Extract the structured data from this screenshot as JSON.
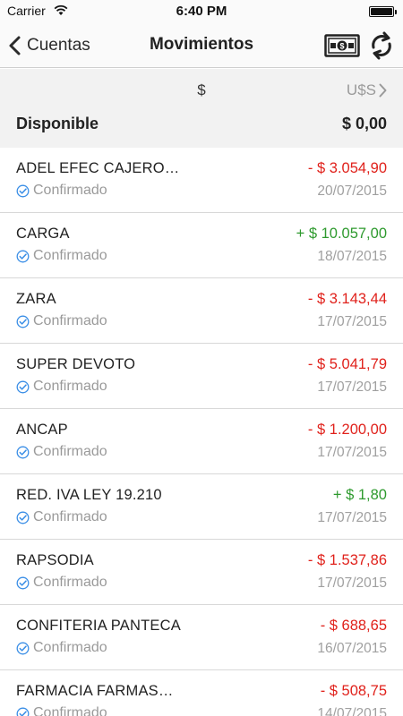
{
  "status_bar": {
    "carrier": "Carrier",
    "time": "6:40 PM"
  },
  "nav": {
    "back_label": "Cuentas",
    "title": "Movimientos"
  },
  "currency": {
    "local": "$",
    "foreign": "U$S"
  },
  "balance": {
    "label": "Disponible",
    "value": "$ 0,00"
  },
  "colors": {
    "negative": "#e0211b",
    "positive": "#2e9a2e",
    "status_icon": "#3a8ee6"
  },
  "transactions": [
    {
      "name": "ADEL EFEC CAJERO…",
      "status": "Confirmado",
      "amount": "- $ 3.054,90",
      "type": "neg",
      "date": "20/07/2015"
    },
    {
      "name": "CARGA",
      "status": "Confirmado",
      "amount": "+ $ 10.057,00",
      "type": "pos",
      "date": "18/07/2015"
    },
    {
      "name": "ZARA",
      "status": "Confirmado",
      "amount": "- $ 3.143,44",
      "type": "neg",
      "date": "17/07/2015"
    },
    {
      "name": "SUPER DEVOTO",
      "status": "Confirmado",
      "amount": "- $ 5.041,79",
      "type": "neg",
      "date": "17/07/2015"
    },
    {
      "name": "ANCAP",
      "status": "Confirmado",
      "amount": "- $ 1.200,00",
      "type": "neg",
      "date": "17/07/2015"
    },
    {
      "name": "RED. IVA LEY 19.210",
      "status": "Confirmado",
      "amount": "+ $ 1,80",
      "type": "pos",
      "date": "17/07/2015"
    },
    {
      "name": "RAPSODIA",
      "status": "Confirmado",
      "amount": "- $ 1.537,86",
      "type": "neg",
      "date": "17/07/2015"
    },
    {
      "name": "CONFITERIA PANTECA",
      "status": "Confirmado",
      "amount": "- $ 688,65",
      "type": "neg",
      "date": "16/07/2015"
    },
    {
      "name": "FARMACIA FARMAS…",
      "status": "Confirmado",
      "amount": "- $ 508,75",
      "type": "neg",
      "date": "14/07/2015"
    }
  ]
}
